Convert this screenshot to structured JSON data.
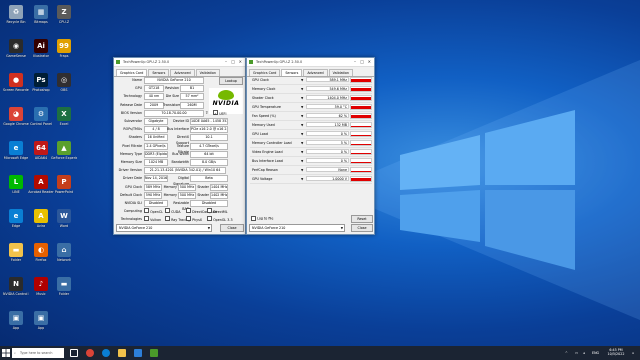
{
  "desktop_icons": [
    {
      "label": "Recycle Bin",
      "color": "#8fa3b8",
      "glyph": "♻"
    },
    {
      "label": "Bitmaps",
      "color": "#3a6ea5",
      "glyph": "▦"
    },
    {
      "label": "CPU-Z",
      "color": "#5a5a5a",
      "glyph": "Z"
    },
    {
      "label": "GameSense",
      "color": "#2b2b2b",
      "glyph": "◉"
    },
    {
      "label": "Illustrator",
      "color": "#330000",
      "glyph": "Ai"
    },
    {
      "label": "Fraps",
      "color": "#e0a000",
      "glyph": "99"
    },
    {
      "label": "Screen Recorder",
      "color": "#d03020",
      "glyph": "●"
    },
    {
      "label": "Photoshop",
      "color": "#001e36",
      "glyph": "Ps"
    },
    {
      "label": "OBS",
      "color": "#302e31",
      "glyph": "◎"
    },
    {
      "label": "Google Chrome",
      "color": "#db4437",
      "glyph": "◕"
    },
    {
      "label": "Control Panel",
      "color": "#2a6fb0",
      "glyph": "⚙"
    },
    {
      "label": "Excel",
      "color": "#1d6f42",
      "glyph": "X"
    },
    {
      "label": "Microsoft Edge",
      "color": "#0a7fd4",
      "glyph": "e"
    },
    {
      "label": "AIDA64",
      "color": "#c01818",
      "glyph": "64"
    },
    {
      "label": "GeForce Experience",
      "color": "#5aa02c",
      "glyph": "▲"
    },
    {
      "label": "LINE",
      "color": "#00b900",
      "glyph": "L"
    },
    {
      "label": "Acrobat Reader",
      "color": "#b30b00",
      "glyph": "A"
    },
    {
      "label": "PowerPoint",
      "color": "#c43e1c",
      "glyph": "P"
    },
    {
      "label": "Edge",
      "color": "#0a7fd4",
      "glyph": "e"
    },
    {
      "label": "Avira",
      "color": "#e8c000",
      "glyph": "A"
    },
    {
      "label": "Word",
      "color": "#2b579a",
      "glyph": "W"
    },
    {
      "label": "Folder",
      "color": "#f1c24b",
      "glyph": "▬"
    },
    {
      "label": "Firefox",
      "color": "#e66000",
      "glyph": "◐"
    },
    {
      "label": "Network",
      "color": "#3a6ea5",
      "glyph": "⌂"
    },
    {
      "label": "NVIDIA Control Panel",
      "color": "#2b2b2b",
      "glyph": "N"
    },
    {
      "label": "Music",
      "color": "#b00000",
      "glyph": "♪"
    },
    {
      "label": "Folder",
      "color": "#3a6ea5",
      "glyph": "▬"
    },
    {
      "label": "App",
      "color": "#3a6ea5",
      "glyph": "▣"
    },
    {
      "label": "App",
      "color": "#3a6ea5",
      "glyph": "▣"
    }
  ],
  "gpuz_main": {
    "title": "TechPowerUp GPU-Z 2.50.0",
    "tabs": [
      "Graphics Card",
      "Sensors",
      "Advanced",
      "Validation"
    ],
    "active_tab": 0,
    "lookup": "Lookup",
    "rows": [
      {
        "label": "Name",
        "value": "NVIDIA GeForce 210"
      },
      {
        "label": "GPU",
        "value": "GT218",
        "l2": "Revision",
        "v2": "B1"
      },
      {
        "label": "Technology",
        "value": "40 nm",
        "l2": "Die Size",
        "v2": "57 mm²"
      },
      {
        "label": "Release Date",
        "value": "2009",
        "l2": "Transistors",
        "v2": "260M"
      },
      {
        "label": "BIOS Version",
        "value": "70.18.70.00.00"
      },
      {
        "label": "Subvendor",
        "value": "Gigabyte",
        "l2": "Device ID",
        "v2": "10DE 0A65 - 1458 3525"
      },
      {
        "label": "ROPs/TMUs",
        "value": "4 / 8",
        "l2": "Bus Interface",
        "v2": "PCIe x16 2.0 @ x16 2.0"
      },
      {
        "label": "Shaders",
        "value": "16 Unified",
        "l2": "DirectX Support",
        "v2": "10.1"
      },
      {
        "label": "Pixel Fillrate",
        "value": "2.4 GPixel/s",
        "l2": "Texture Fillrate",
        "v2": "4.7 GTexel/s"
      },
      {
        "label": "Memory Type",
        "value": "DDR3 (Elpida)",
        "l2": "Bus Width",
        "v2": "64 bit"
      },
      {
        "label": "Memory Size",
        "value": "1024 MB",
        "l2": "Bandwidth",
        "v2": "8.0 GB/s"
      },
      {
        "label": "Driver Version",
        "value": "21.21.13.4201 (NVIDIA 342.01) / Win10 64"
      },
      {
        "label": "Driver Date",
        "value": "Nov 14, 2016",
        "l2": "Digital Signature",
        "v2": "Beta"
      },
      {
        "label": "GPU Clock",
        "value": "589 MHz",
        "l2": "Memory",
        "v2": "500 MHz",
        "l3": "Shader",
        "v3": "1404 MHz"
      },
      {
        "label": "Default Clock",
        "value": "590 MHz",
        "l2": "Memory",
        "v2": "500 MHz",
        "l3": "Shader",
        "v3": "1402 MHz"
      },
      {
        "label": "NVIDIA SLI",
        "value": "Disabled",
        "l2": "Resizable BAR",
        "v2": "Disabled"
      }
    ],
    "uefi": "UEFI",
    "computing_label": "Computing",
    "computing": [
      "OpenCL",
      "CUDA",
      "DirectCompute",
      "DirectML"
    ],
    "tech_label": "Technologies",
    "tech": [
      "Vulkan",
      "Ray Tracing",
      "PhysX",
      "OpenGL 3.3"
    ],
    "select": "NVIDIA GeForce 210",
    "close": "Close"
  },
  "gpuz_sensors": {
    "title": "TechPowerUp GPU-Z 2.50.0",
    "tabs": [
      "Graphics Card",
      "Sensors",
      "Advanced",
      "Validation"
    ],
    "active_tab": 1,
    "sensors": [
      {
        "name": "GPU Clock",
        "value": "589.1 MHz",
        "level": 0.85
      },
      {
        "name": "Memory Clock",
        "value": "549.6 MHz",
        "level": 0.85
      },
      {
        "name": "Shader Clock",
        "value": "1404.0 MHz",
        "level": 0.85
      },
      {
        "name": "GPU Temperature",
        "value": "59.0 °C",
        "level": 0.85
      },
      {
        "name": "Fan Speed (%)",
        "value": "62 %",
        "level": 0.85
      },
      {
        "name": "Memory Used",
        "value": "132 MB",
        "level": 0.1
      },
      {
        "name": "GPU Load",
        "value": "0 %",
        "level": 0.0
      },
      {
        "name": "Memory Controller Load",
        "value": "5 %",
        "level": 0.05
      },
      {
        "name": "Video Engine Load",
        "value": "0 %",
        "level": 0.0
      },
      {
        "name": "Bus Interface Load",
        "value": "0 %",
        "level": 0.0
      },
      {
        "name": "PerfCap Reason",
        "value": "None",
        "level": 0.0
      },
      {
        "name": "GPU Voltage",
        "value": "1.0000 V",
        "level": 0.85
      }
    ],
    "log": "Log to file",
    "reset": "Reset",
    "select": "NVIDIA GeForce 210",
    "close": "Close"
  },
  "taskbar": {
    "search": "Type here to search",
    "time": "6:45 PM",
    "date": "10/5/2022",
    "lang": "ENG"
  }
}
